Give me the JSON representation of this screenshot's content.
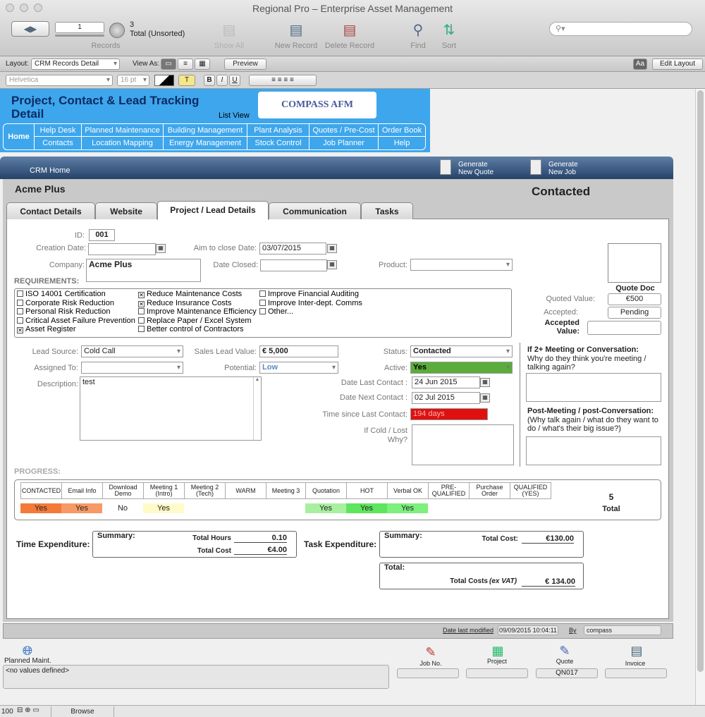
{
  "window": {
    "title": "Regional Pro – Enterprise Asset Management"
  },
  "toolbar": {
    "record_number": "1",
    "records_count": "3",
    "records_status": "Total (Unsorted)",
    "records_label": "Records",
    "show_all": "Show All",
    "new_record": "New Record",
    "delete_record": "Delete Record",
    "find": "Find",
    "sort": "Sort",
    "search_placeholder": ""
  },
  "layoutbar": {
    "layout_label": "Layout:",
    "layout_value": "CRM Records Detail",
    "view_as_label": "View As:",
    "preview": "Preview",
    "aa": "Aa",
    "edit_layout": "Edit Layout"
  },
  "formatbar": {
    "font": "Helvetica",
    "size": "16 pt",
    "bold": "B",
    "italic": "I",
    "underline": "U",
    "text_color_glyph": "T"
  },
  "header": {
    "title": "Project, Contact & Lead Tracking Detail",
    "list_view": "List View",
    "logo": "COMPASS AFM",
    "home": "Home",
    "nav_row1": [
      "Help Desk",
      "Planned Maintenance",
      "Building Management",
      "Plant Analysis",
      "Quotes / Pre-Cost",
      "Order Book"
    ],
    "nav_row2": [
      "Contacts",
      "Location Mapping",
      "Energy Management",
      "Stock Control",
      "Job Planner",
      "Help"
    ]
  },
  "crmbar": {
    "home": "CRM Home",
    "gen_quote": "Generate\nNew Quote",
    "gen_job": "Generate\nNew Job"
  },
  "record": {
    "company_title": "Acme Plus",
    "status_big": "Contacted"
  },
  "tabs": [
    "Contact Details",
    "Website",
    "Project / Lead Details",
    "Communication",
    "Tasks"
  ],
  "form": {
    "id_label": "ID:",
    "id": "001",
    "creation_label": "Creation Date:",
    "creation": "",
    "aim_label": "Aim to close Date:",
    "aim": "03/07/2015",
    "company_label": "Company:",
    "company": "Acme Plus",
    "closed_label": "Date Closed:",
    "closed": "",
    "product_label": "Product:",
    "product": "",
    "quote_doc": "Quote Doc",
    "quoted_label": "Quoted Value:",
    "quoted": "€500",
    "accepted_label": "Accepted:",
    "accepted": "Pending",
    "accepted_value_label": "Accepted\nValue:",
    "accepted_value": "",
    "requirements_label": "REQUIREMENTS:",
    "req_col1": [
      {
        "label": "ISO 14001 Certification",
        "checked": false
      },
      {
        "label": "Corporate Risk Reduction",
        "checked": false
      },
      {
        "label": "Personal Risk Reduction",
        "checked": false
      },
      {
        "label": "Critical Asset Failure Prevention",
        "checked": false
      },
      {
        "label": "Asset Register",
        "checked": true
      }
    ],
    "req_col2": [
      {
        "label": "Reduce Maintenance Costs",
        "checked": true
      },
      {
        "label": "Reduce Insurance Costs",
        "checked": true
      },
      {
        "label": "Improve Maintenance Efficiency",
        "checked": false
      },
      {
        "label": "Replace Paper / Excel System",
        "checked": false
      },
      {
        "label": "Better control of Contractors",
        "checked": false
      }
    ],
    "req_col3": [
      {
        "label": "Improve Financial Auditing",
        "checked": false
      },
      {
        "label": "Improve Inter-dept. Comms",
        "checked": false
      },
      {
        "label": "Other...",
        "checked": false
      }
    ],
    "lead_source_label": "Lead Source:",
    "lead_source": "Cold Call",
    "sales_value_label": "Sales Lead Value:",
    "sales_value": "€ 5,000",
    "status_label": "Status:",
    "status": "Contacted",
    "assigned_label": "Assigned To:",
    "assigned": "",
    "potential_label": "Potential:",
    "potential": "Low",
    "active_label": "Active:",
    "active": "Yes",
    "description_label": "Description:",
    "description": "test",
    "last_contact_label": "Date Last Contact :",
    "last_contact": "24 Jun 2015",
    "next_contact_label": "Date Next Contact :",
    "next_contact": "02 Jul 2015",
    "time_since_label": "Time since Last Contact:",
    "time_since": "194 days",
    "cold_label": "If Cold / Lost\nWhy?",
    "q1_label": "If 2+ Meeting or Conversation:",
    "q1_sub": "Why do they think you're meeting / talking again?",
    "q2_label": "Post-Meeting / post-Conversation:",
    "q2_sub": "(Why talk again / what do they want to do / what's their big issue?)"
  },
  "progress": {
    "label": "PROGRESS:",
    "stages": [
      "CONTACTED",
      "Email Info",
      "Download Demo",
      "Meeting 1 (Intro)",
      "Meeting 2 (Tech)",
      "WARM",
      "Meeting 3",
      "Quotation",
      "HOT",
      "Verbal OK",
      "PRE-QUALIFIED",
      "Purchase Order",
      "QUALIFIED (YES)"
    ],
    "values": [
      "Yes",
      "Yes",
      "No",
      "Yes",
      "",
      "",
      "",
      "Yes",
      "Yes",
      "Yes",
      "",
      "",
      ""
    ],
    "colors": [
      "#f47a3a",
      "#f79a66",
      "#ffffff",
      "#fffbc8",
      "#ffffff",
      "#ffffff",
      "#ffffff",
      "#a8f0a0",
      "#5de65d",
      "#7df07d",
      "#ffffff",
      "#ffffff",
      "#ffffff"
    ],
    "total": "5",
    "total_label": "Total"
  },
  "expenditure": {
    "time_label": "Time Expenditure:",
    "summary": "Summary:",
    "total_hours_label": "Total Hours",
    "total_hours": "0.10",
    "total_cost_label": "Total Cost",
    "total_cost": "€4.00",
    "task_label": "Task Expenditure:",
    "task_cost_label": "Total Cost:",
    "task_cost": "€130.00",
    "total_label": "Total:",
    "total_costs_label": "Total Costs",
    "ex_vat": "(ex VAT)",
    "total_costs": "€ 134.00"
  },
  "footer": {
    "modified_label": "Date last modified",
    "modified": "09/09/2015 10:04:11",
    "by_label": "By",
    "by": "compass",
    "planned": "Planned Maint.",
    "no_values": "<no values defined>",
    "job_no": "Job No.",
    "project": "Project",
    "quote": "Quote",
    "invoice": "Invoice",
    "quote_value": "QN017"
  },
  "statusbar": {
    "zoom": "100",
    "mode": "Browse"
  }
}
